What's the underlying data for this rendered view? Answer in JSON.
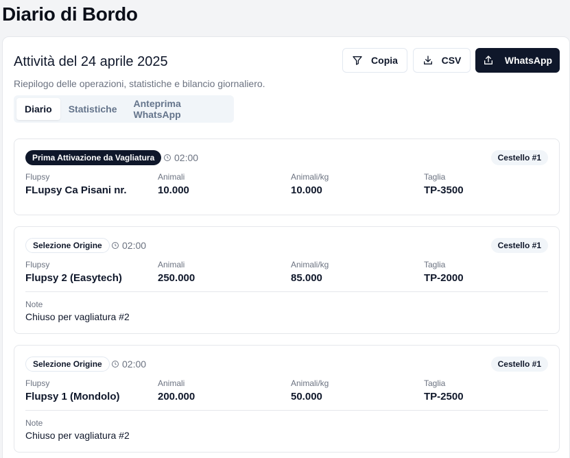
{
  "page": {
    "title": "Diario di Bordo"
  },
  "panel": {
    "title": "Attività del 24 aprile 2025",
    "subtitle": "Riepilogo delle operazioni, statistiche e bilancio giornaliero.",
    "buttons": {
      "copy": "Copia",
      "csv": "CSV",
      "whatsapp": "WhatsApp"
    },
    "tabs": [
      "Diario",
      "Statistiche",
      "Anteprima WhatsApp"
    ],
    "active_tab": "Diario"
  },
  "field_labels": {
    "flupsy": "Flupsy",
    "animali": "Animali",
    "animali_kg": "Animali/kg",
    "taglia": "Taglia",
    "note": "Note"
  },
  "operations": [
    {
      "type": "Prima Attivazione da Vagliatura",
      "time": "02:00",
      "cestello": "Cestello #1",
      "flupsy": "FLupsy Ca Pisani nr.",
      "animali": "10.000",
      "animali_kg": "10.000",
      "taglia": "TP-3500",
      "note": ""
    },
    {
      "type": "Selezione Origine",
      "time": "02:00",
      "cestello": "Cestello #1",
      "flupsy": "Flupsy 2 (Easytech)",
      "animali": "250.000",
      "animali_kg": "85.000",
      "taglia": "TP-2000",
      "note": "Chiuso per vagliatura #2"
    },
    {
      "type": "Selezione Origine",
      "time": "02:00",
      "cestello": "Cestello #1",
      "flupsy": "Flupsy 1 (Mondolo)",
      "animali": "200.000",
      "animali_kg": "50.000",
      "taglia": "TP-2500",
      "note": "Chiuso per vagliatura #2"
    }
  ],
  "icons": {
    "copy": "filter-icon",
    "csv": "download-icon",
    "whatsapp": "share-icon",
    "time": "clock-icon"
  }
}
